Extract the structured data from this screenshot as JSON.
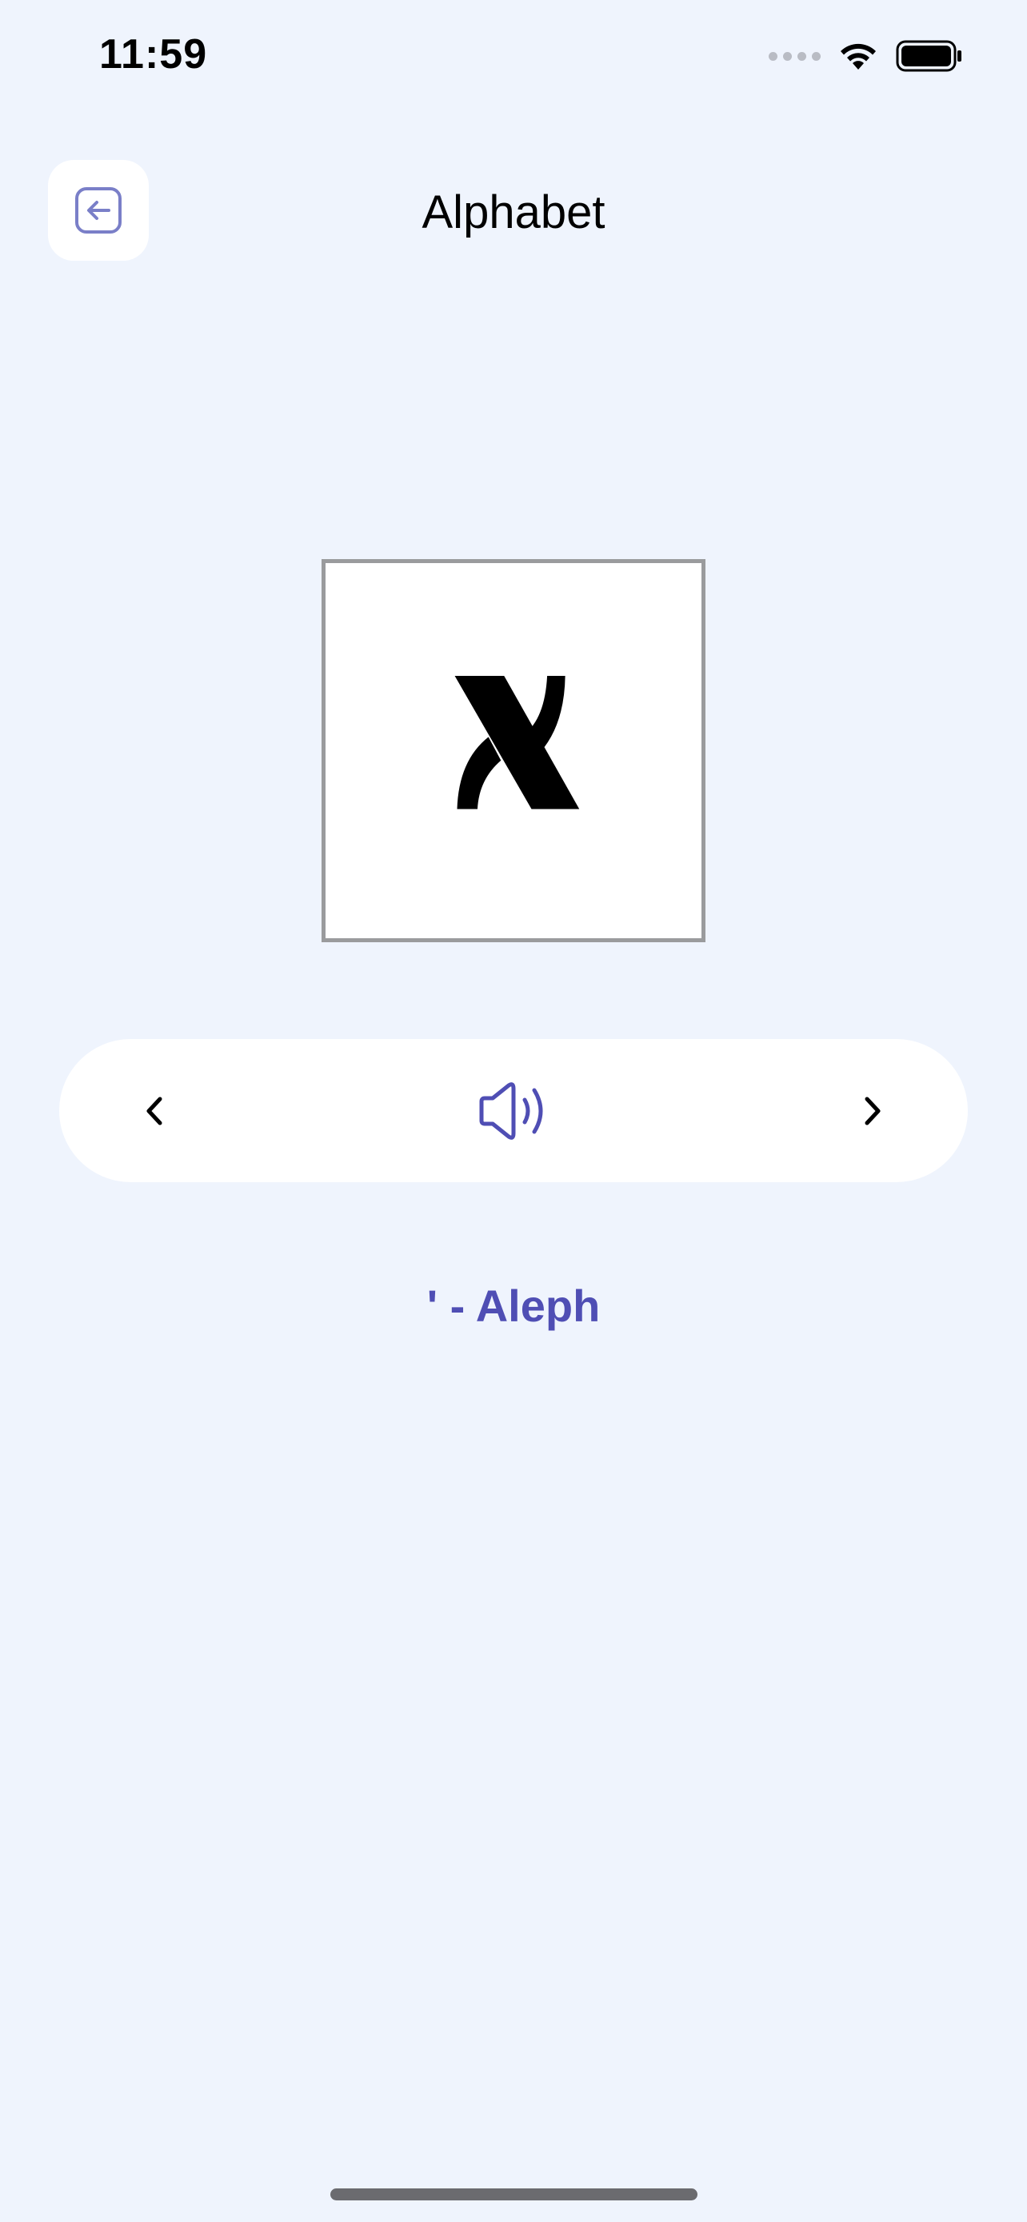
{
  "status_bar": {
    "time": "11:59",
    "icons": [
      "signal-dots-icon",
      "wifi-icon",
      "battery-icon"
    ]
  },
  "header": {
    "title": "Alphabet",
    "back_icon": "back-arrow-icon"
  },
  "letter_card": {
    "glyph": "א"
  },
  "controls": {
    "prev_icon": "chevron-left-icon",
    "speaker_icon": "speaker-icon",
    "next_icon": "chevron-right-icon"
  },
  "letter_name": "' - Aleph",
  "colors": {
    "background": "#eff4fd",
    "accent": "#4f4eb4",
    "card_border": "#9a9b9d"
  }
}
